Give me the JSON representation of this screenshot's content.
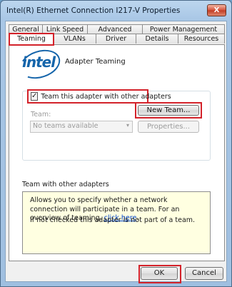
{
  "window": {
    "title": "Intel(R) Ethernet Connection I217-V Properties",
    "close_label": "X"
  },
  "tabs": {
    "row1": [
      "General",
      "Link Speed",
      "Advanced",
      "Power Management"
    ],
    "row2": [
      "Teaming",
      "VLANs",
      "Driver",
      "Details",
      "Resources"
    ],
    "active": "Teaming"
  },
  "logo": {
    "text": "intel"
  },
  "page": {
    "heading": "Adapter Teaming",
    "team_checkbox": {
      "label": "Team this adapter with other adapters",
      "checked": true,
      "mark": "✓"
    },
    "new_team_button": "New Team...",
    "team_field_label": "Team:",
    "team_select": {
      "value": "No teams available",
      "arrow": "▾"
    },
    "properties_button": "Properties...",
    "info_title": "Team with other adapters",
    "info_text_pre": "Allows you to specify whether a network connection will participate in a team. For an overview of teaming,",
    "info_link": "click here",
    "info_text_post": ".",
    "info_text_2": "If not checked this adapter is not part of a team."
  },
  "footer": {
    "ok_label": "OK",
    "cancel_label": "Cancel"
  }
}
